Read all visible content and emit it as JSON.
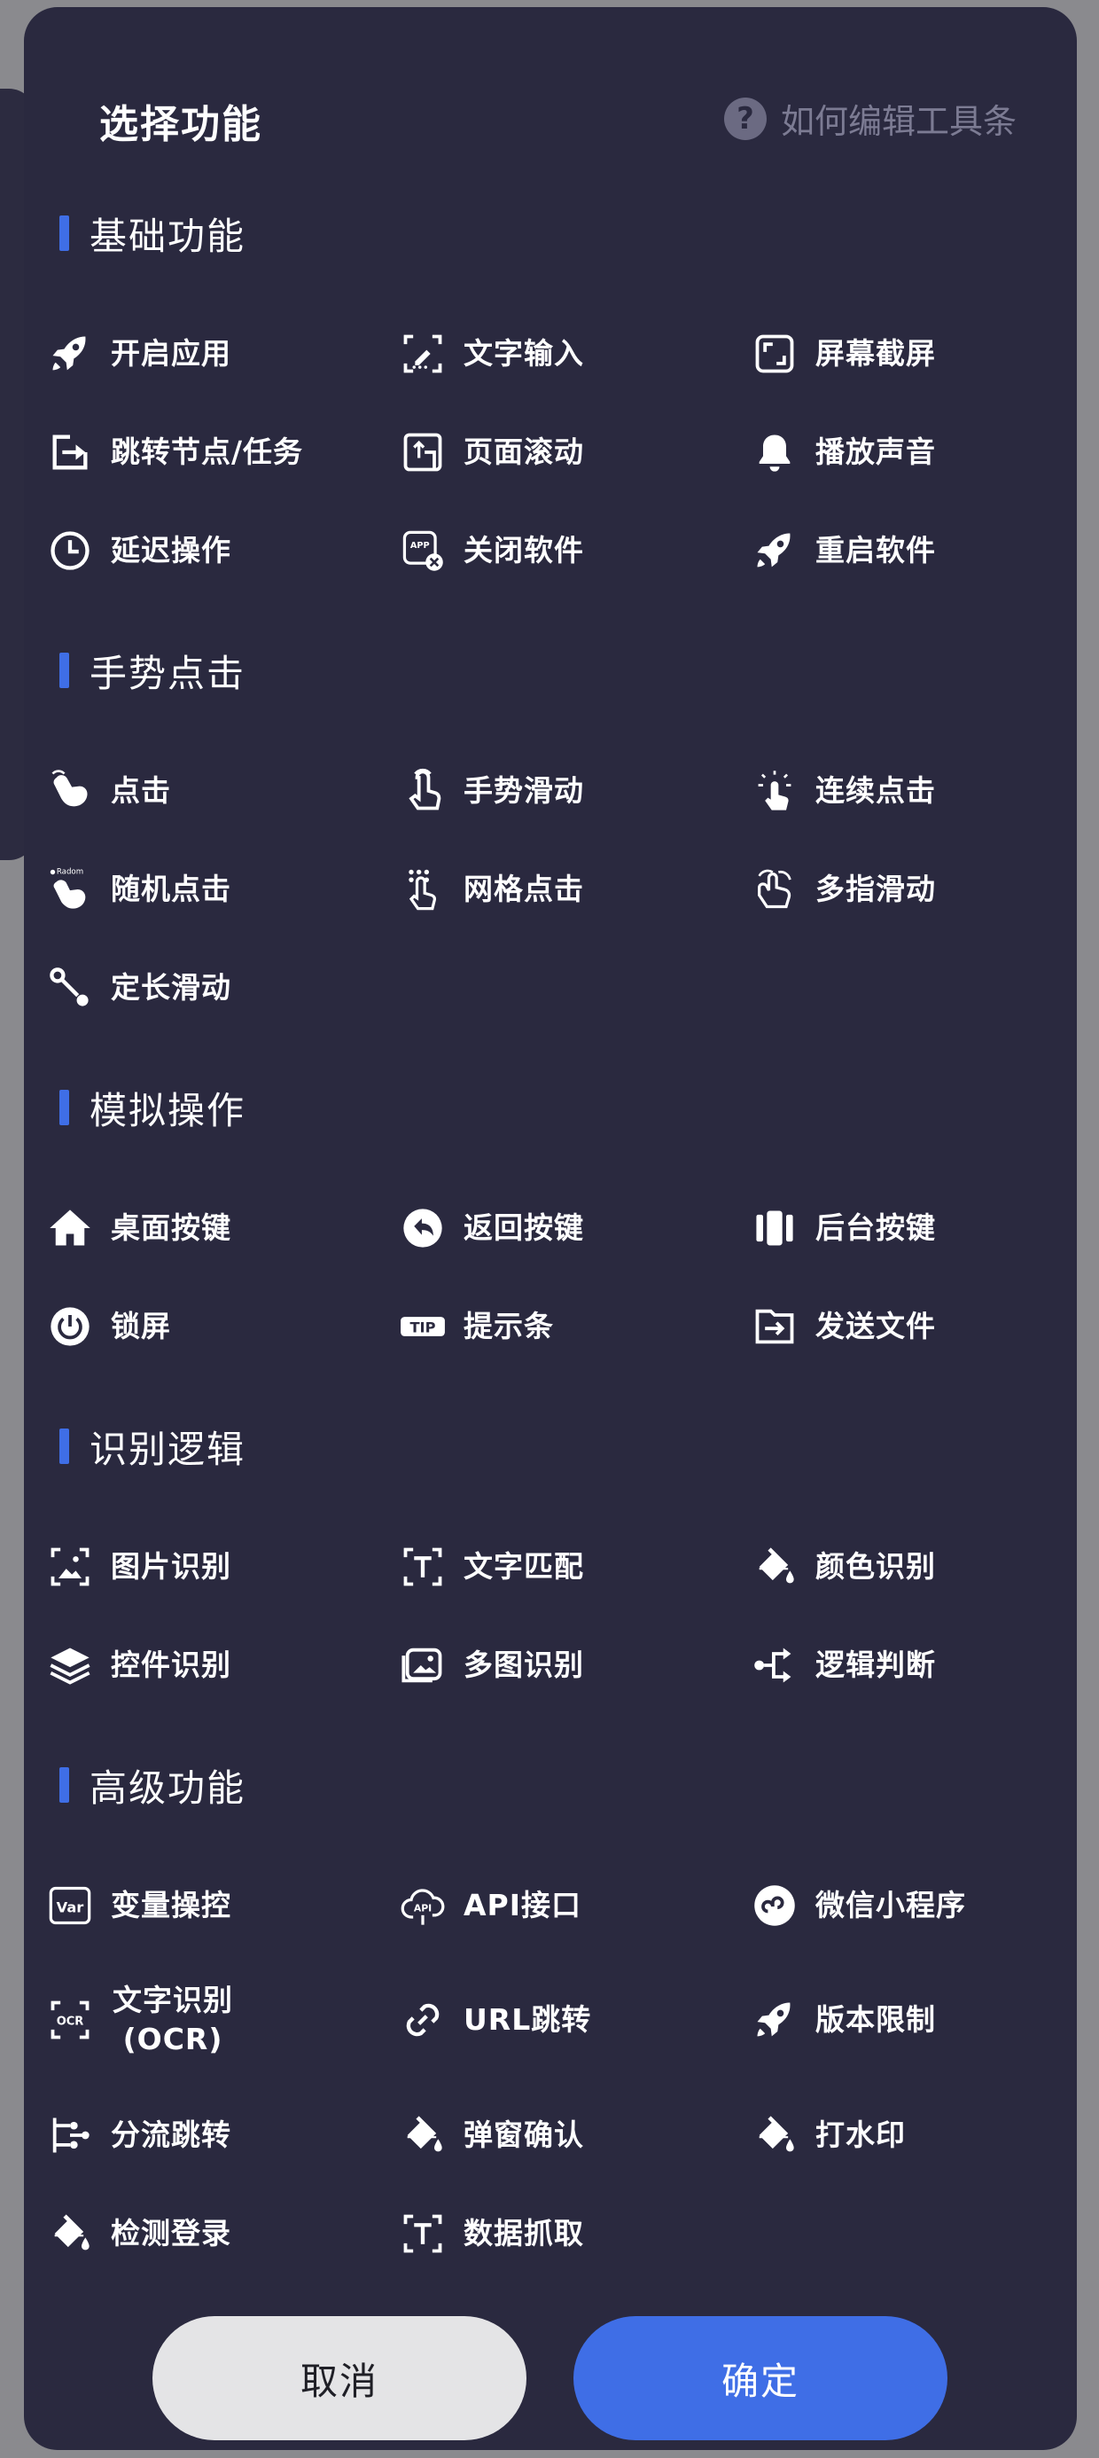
{
  "header": {
    "title": "选择功能",
    "help_label": "如何编辑工具条",
    "help_icon": "?"
  },
  "sections": [
    {
      "title": "基础功能",
      "items": [
        {
          "label": "开启应用",
          "icon": "rocket-icon"
        },
        {
          "label": "文字输入",
          "icon": "text-input-icon"
        },
        {
          "label": "屏幕截屏",
          "icon": "screenshot-icon"
        },
        {
          "label": "跳转节点/任务",
          "icon": "jump-icon"
        },
        {
          "label": "页面滚动",
          "icon": "scroll-icon"
        },
        {
          "label": "播放声音",
          "icon": "bell-icon"
        },
        {
          "label": "延迟操作",
          "icon": "clock-icon"
        },
        {
          "label": "关闭软件",
          "icon": "close-app-icon"
        },
        {
          "label": "重启软件",
          "icon": "rocket-icon"
        }
      ]
    },
    {
      "title": "手势点击",
      "items": [
        {
          "label": "点击",
          "icon": "tap-icon"
        },
        {
          "label": "手势滑动",
          "icon": "swipe-icon"
        },
        {
          "label": "连续点击",
          "icon": "multi-tap-icon"
        },
        {
          "label": "随机点击",
          "icon": "random-tap-icon"
        },
        {
          "label": "网格点击",
          "icon": "grid-tap-icon"
        },
        {
          "label": "多指滑动",
          "icon": "multi-finger-icon"
        },
        {
          "label": "定长滑动",
          "icon": "fixed-swipe-icon"
        }
      ]
    },
    {
      "title": "模拟操作",
      "items": [
        {
          "label": "桌面按键",
          "icon": "home-icon"
        },
        {
          "label": "返回按键",
          "icon": "back-icon"
        },
        {
          "label": "后台按键",
          "icon": "recents-icon"
        },
        {
          "label": "锁屏",
          "icon": "power-icon"
        },
        {
          "label": "提示条",
          "icon": "tip-icon"
        },
        {
          "label": "发送文件",
          "icon": "send-file-icon"
        }
      ]
    },
    {
      "title": "识别逻辑",
      "items": [
        {
          "label": "图片识别",
          "icon": "image-recognize-icon"
        },
        {
          "label": "文字匹配",
          "icon": "text-match-icon"
        },
        {
          "label": "颜色识别",
          "icon": "paint-bucket-icon"
        },
        {
          "label": "控件识别",
          "icon": "layers-icon"
        },
        {
          "label": "多图识别",
          "icon": "multi-image-icon"
        },
        {
          "label": "逻辑判断",
          "icon": "logic-branch-icon"
        }
      ]
    },
    {
      "title": "高级功能",
      "items": [
        {
          "label": "变量操控",
          "icon": "var-icon"
        },
        {
          "label": "API接口",
          "icon": "api-cloud-icon"
        },
        {
          "label": "微信小程序",
          "icon": "mini-program-icon"
        },
        {
          "label": "文字识别\n(OCR)",
          "icon": "ocr-icon"
        },
        {
          "label": "URL跳转",
          "icon": "link-icon"
        },
        {
          "label": "版本限制",
          "icon": "rocket-icon"
        },
        {
          "label": "分流跳转",
          "icon": "split-icon"
        },
        {
          "label": "弹窗确认",
          "icon": "paint-bucket-icon"
        },
        {
          "label": "打水印",
          "icon": "paint-bucket-icon"
        },
        {
          "label": "检测登录",
          "icon": "paint-bucket-icon"
        },
        {
          "label": "数据抓取",
          "icon": "text-match-icon"
        }
      ]
    }
  ],
  "icon_glyphs": {
    "var": "Var",
    "ocr": "OCR",
    "tip": "TIP",
    "app": "APP",
    "random": "Radom",
    "api": "API"
  },
  "footer": {
    "cancel_label": "取消",
    "confirm_label": "确定"
  },
  "colors": {
    "panel_bg": "#2a293f",
    "accent": "#3f6ee6",
    "cancel_bg": "#e4e4e6",
    "muted": "#7c7b93"
  }
}
